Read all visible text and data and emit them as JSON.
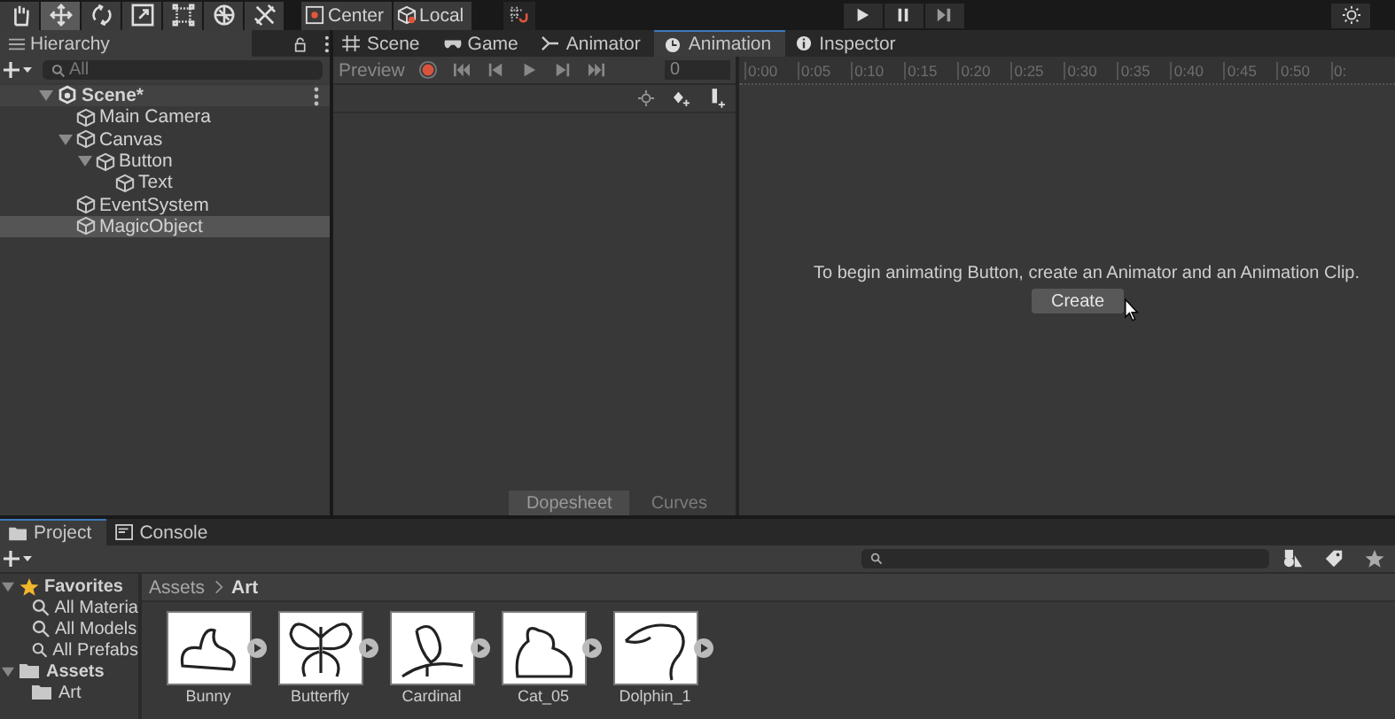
{
  "toolbar": {
    "tools": [
      {
        "selected": false
      },
      {
        "selected": true
      },
      {
        "selected": false
      },
      {
        "selected": false
      },
      {
        "selected": false
      },
      {
        "selected": false
      },
      {
        "selected": false
      }
    ],
    "pivot_buttons": [
      "Center",
      "Local"
    ],
    "play_controls": [
      {
        "selected": false
      },
      {
        "selected": false
      },
      {
        "selected": false
      }
    ]
  },
  "hierarchy": {
    "title": "Hierarchy",
    "search": {
      "placeholder": "All"
    },
    "tree": [
      {
        "label": "Scene*",
        "kind": "scene",
        "expanded": true,
        "selected": false,
        "children": [
          {
            "label": "Main Camera",
            "kind": "object",
            "selected": false
          },
          {
            "label": "Canvas",
            "kind": "object",
            "expanded": true,
            "selected": false,
            "children": [
              {
                "label": "Button",
                "kind": "object",
                "expanded": true,
                "selected": false,
                "children": [
                  {
                    "label": "Text",
                    "kind": "object",
                    "selected": false
                  }
                ]
              }
            ]
          },
          {
            "label": "EventSystem",
            "kind": "object",
            "selected": false
          },
          {
            "label": "MagicObject",
            "kind": "object",
            "selected": true
          }
        ]
      }
    ]
  },
  "tabs": [
    {
      "label": "Scene",
      "selected": false
    },
    {
      "label": "Game",
      "selected": false
    },
    {
      "label": "Animator",
      "selected": false
    },
    {
      "label": "Animation",
      "selected": true
    },
    {
      "label": "Inspector",
      "selected": false
    }
  ],
  "animation": {
    "preview": "Preview",
    "frame": "0",
    "ruler": [
      "0:00",
      "0:05",
      "0:10",
      "0:15",
      "0:20",
      "0:25",
      "0:30",
      "0:35",
      "0:40",
      "0:45",
      "0:50",
      "0:"
    ],
    "message": "To begin animating Button, create an Animator and an Animation Clip.",
    "create_button": "Create",
    "view_tabs": [
      {
        "label": "Dopesheet",
        "selected": true
      },
      {
        "label": "Curves",
        "selected": false
      }
    ]
  },
  "project": {
    "tabs": [
      {
        "label": "Project",
        "selected": true
      },
      {
        "label": "Console",
        "selected": false
      }
    ],
    "sidebar": [
      {
        "label": "Favorites",
        "kind": "favorites",
        "expanded": true,
        "children": [
          {
            "label": "All Materia",
            "kind": "search"
          },
          {
            "label": "All Models",
            "kind": "search"
          },
          {
            "label": "All Prefabs",
            "kind": "search"
          }
        ]
      },
      {
        "label": "Assets",
        "kind": "folder",
        "expanded": true,
        "children": [
          {
            "label": "Art",
            "kind": "folder"
          }
        ]
      }
    ],
    "breadcrumb": [
      "Assets",
      "Art"
    ],
    "assets": [
      {
        "name": "Bunny"
      },
      {
        "name": "Butterfly"
      },
      {
        "name": "Cardinal"
      },
      {
        "name": "Cat_05"
      },
      {
        "name": "Dolphin_1"
      }
    ]
  }
}
